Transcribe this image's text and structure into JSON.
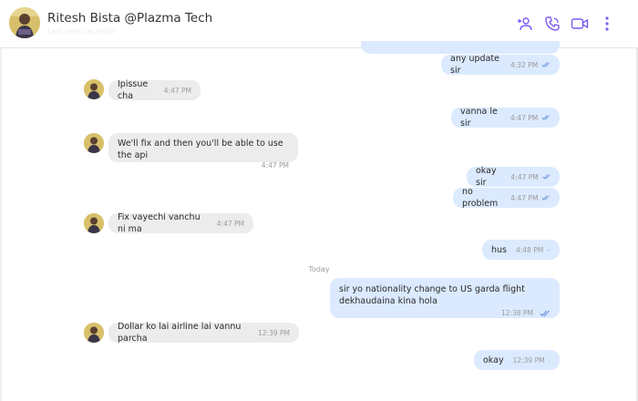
{
  "header": {
    "contact_name": "Ritesh Bista @Plazma Tech",
    "status": "Last seen recently"
  },
  "icons": {
    "add_user": "add-user-icon",
    "call": "phone-icon",
    "video": "video-icon",
    "more": "more-vertical-icon"
  },
  "colors": {
    "accent": "#7c5cf3",
    "outgoing_bubble": "#dbeafe",
    "incoming_bubble": "#ececec",
    "read_tick": "#6d8fe0"
  },
  "messages": [
    {
      "dir": "out",
      "text": "any update sir",
      "time": "4:32 PM",
      "read": true
    },
    {
      "dir": "in",
      "text": "Ipissue cha",
      "time": "4:47 PM"
    },
    {
      "dir": "out",
      "text": "vanna le sir",
      "time": "4:47 PM",
      "read": true
    },
    {
      "dir": "in",
      "text": "We'll fix and then you'll be able to use the api",
      "time": "4:47 PM"
    },
    {
      "dir": "out",
      "text": "okay sir",
      "time": "4:47 PM",
      "read": true
    },
    {
      "dir": "out",
      "text": "no problem",
      "time": "4:47 PM",
      "read": true
    },
    {
      "dir": "in",
      "text": "Fix vayechi vanchu ni ma",
      "time": "4:47 PM"
    },
    {
      "dir": "out",
      "text": "hus",
      "time": "4:48 PM",
      "read": true
    },
    {
      "dir": "out",
      "text": "sir yo nationality change to US garda flight dekhaudaina kina hola",
      "time": "12:38 PM",
      "read": true
    },
    {
      "dir": "in",
      "text": "Dollar ko lai airline lai vannu parcha",
      "time": "12:39 PM"
    },
    {
      "dir": "out",
      "text": "okay",
      "time": "12:39 PM",
      "read": true
    }
  ],
  "day_separator": "Today"
}
